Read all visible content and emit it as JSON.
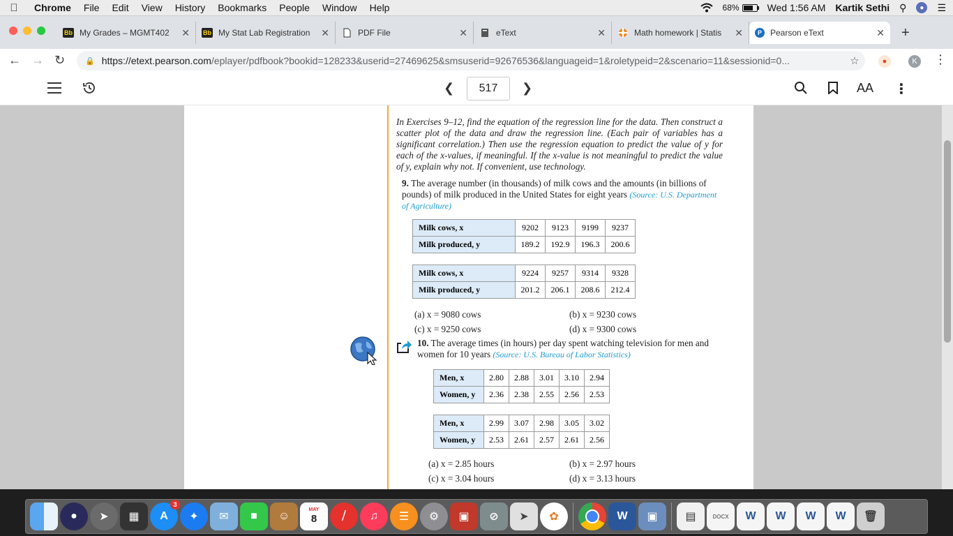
{
  "menubar": {
    "app": "Chrome",
    "items": [
      "File",
      "Edit",
      "View",
      "History",
      "Bookmarks",
      "People",
      "Window",
      "Help"
    ],
    "battery": "68%",
    "clock": "Wed 1:56 AM",
    "user": "Kartik Sethi"
  },
  "tabs": [
    {
      "favicon": "Bb",
      "title": "My Grades – MGMT402"
    },
    {
      "favicon": "Bb",
      "title": "My Stat Lab Registration"
    },
    {
      "favicon": "doc-icon",
      "title": "PDF File"
    },
    {
      "favicon": "etext-icon",
      "title": "eText"
    },
    {
      "favicon": "circle-icon",
      "title": "Math homework | Statis"
    },
    {
      "favicon": "P",
      "title": "Pearson eText"
    }
  ],
  "address": {
    "host": "https://etext.pearson.com",
    "path": "/eplayer/pdfbook?bookid=128233&userid=27469625&smsuserid=92676536&languageid=1&roletypeid=2&scenario=11&sessionid=0...",
    "profile_initial": "K"
  },
  "toolbar": {
    "page_number": "517",
    "font_label": "AA"
  },
  "page": {
    "intro": "In Exercises 9–12, find the equation of the regression line for the data. Then construct a scatter plot of the data and draw the regression line. (Each pair of variables has a significant correlation.) Then use the regression equation to predict the value of y for each of the x-values, if meaningful. If the x-value is not meaningful to predict the value of y, explain why not. If convenient, use technology.",
    "ex9": {
      "number": "9.",
      "text": "The average number (in thousands) of milk cows and the amounts (in billions of pounds) of milk produced in the United States for eight years",
      "source": "(Source: U.S. Department of Agriculture)",
      "x_label": "Milk cows, x",
      "y_label": "Milk produced, y",
      "table1": {
        "x": [
          "9202",
          "9123",
          "9199",
          "9237"
        ],
        "y": [
          "189.2",
          "192.9",
          "196.3",
          "200.6"
        ]
      },
      "table2": {
        "x": [
          "9224",
          "9257",
          "9314",
          "9328"
        ],
        "y": [
          "201.2",
          "206.1",
          "208.6",
          "212.4"
        ]
      },
      "choices": [
        "(a) x = 9080 cows",
        "(b) x = 9230 cows",
        "(c) x = 9250 cows",
        "(d) x = 9300 cows"
      ]
    },
    "ex10": {
      "number": "10.",
      "text": "The average times (in hours) per day spent watching television for men and women for 10 years",
      "source": "(Source: U.S. Bureau of Labor Statistics)",
      "x_label": "Men, x",
      "y_label": "Women, y",
      "table1": {
        "x": [
          "2.80",
          "2.88",
          "3.01",
          "3.10",
          "2.94"
        ],
        "y": [
          "2.36",
          "2.38",
          "2.55",
          "2.56",
          "2.53"
        ]
      },
      "table2": {
        "x": [
          "2.99",
          "3.07",
          "2.98",
          "3.05",
          "3.02"
        ],
        "y": [
          "2.53",
          "2.61",
          "2.57",
          "2.61",
          "2.56"
        ]
      },
      "choices": [
        "(a) x = 2.85 hours",
        "(b) x = 2.97 hours",
        "(c) x = 3.04 hours",
        "(d) x = 3.13 hours"
      ]
    }
  },
  "dock": {
    "calendar_month": "MAY",
    "calendar_day": "8",
    "appstore_badge": "3"
  },
  "colors": {
    "accent_rule": "#f0a93b",
    "table_header": "#dcebf7",
    "source_blue": "#1d9bd1"
  }
}
